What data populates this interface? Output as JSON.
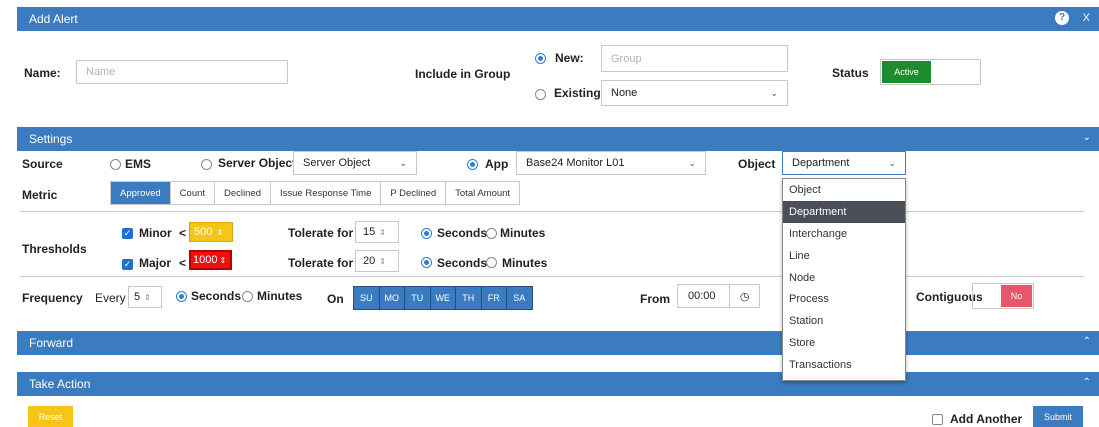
{
  "header": {
    "title": "Add Alert",
    "help_icon": "question-circle-icon",
    "close_label": "X"
  },
  "top": {
    "name_label": "Name:",
    "name_placeholder": "Name",
    "group_label": "Include in Group",
    "new_label": "New:",
    "group_placeholder": "Group",
    "existing_label": "Existing",
    "existing_value": "None",
    "status_label": "Status",
    "status_active": "Active"
  },
  "settings": {
    "title": "Settings",
    "source_label": "Source",
    "ems_label": "EMS",
    "server_object_label": "Server Object",
    "server_object_value": "Server Object",
    "app_label": "App",
    "app_value": "Base24 Monitor L01",
    "object_label": "Object",
    "object_value": "Department",
    "metric_label": "Metric",
    "metrics": [
      "Approved",
      "Count",
      "Declined",
      "Issue Response Time",
      "P Declined",
      "Total Amount"
    ],
    "thresholds_label": "Thresholds",
    "minor_label": "Minor",
    "minor_op": "<",
    "minor_value": "500",
    "major_label": "Major",
    "major_op": "<",
    "major_value": "1000",
    "tolerate_label": "Tolerate for",
    "minor_tolerate": "15",
    "major_tolerate": "20",
    "seconds_label": "Seconds",
    "minutes_label": "Minutes",
    "frequency_label": "Frequency",
    "every_label": "Every",
    "every_value": "5",
    "on_label": "On",
    "days": [
      "SU",
      "MO",
      "TU",
      "WE",
      "TH",
      "FR",
      "SA"
    ],
    "from_label": "From",
    "from_value": "00:00",
    "contiguous_label": "Contiguous",
    "contiguous_value": "No"
  },
  "dropdown": {
    "options": [
      "Object",
      "Department",
      "Interchange",
      "Line",
      "Node",
      "Process",
      "Station",
      "Store",
      "Transactions"
    ],
    "selected": "Department"
  },
  "forward": {
    "title": "Forward"
  },
  "take_action": {
    "title": "Take Action"
  },
  "footer": {
    "reset": "Reset",
    "add_another": "Add Another",
    "submit": "Submit"
  },
  "colors": {
    "accent": "#3b7bbf",
    "active_green": "#1e8c2c",
    "no_red": "#e9566a",
    "reset_yellow": "#f5c518",
    "minor_amber": "#f5c518",
    "major_red": "#e11"
  }
}
